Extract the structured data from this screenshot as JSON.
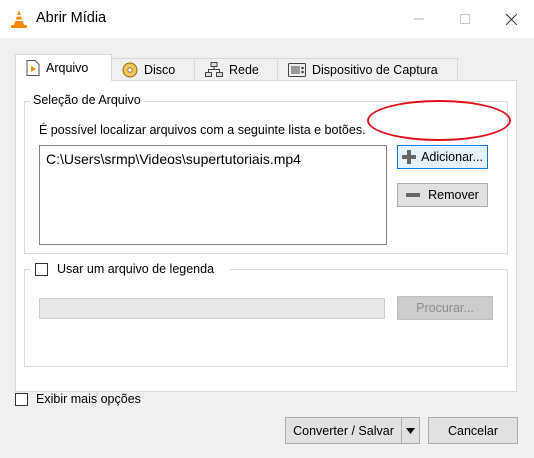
{
  "window": {
    "title": "Abrir Mídia",
    "minimize_icon": "minimize-icon",
    "maximize_icon": "maximize-icon",
    "close_icon": "close-icon"
  },
  "tabs": [
    {
      "label": "Arquivo",
      "icon": "file-play-icon",
      "active": true
    },
    {
      "label": "Disco",
      "icon": "disc-icon",
      "active": false
    },
    {
      "label": "Rede",
      "icon": "network-icon",
      "active": false
    },
    {
      "label": "Dispositivo de Captura",
      "icon": "capture-device-icon",
      "active": false
    }
  ],
  "file_selection": {
    "legend": "Seleção de Arquivo",
    "hint": "É possível localizar arquivos com a seguinte lista e botões.",
    "files": [
      "C:\\Users\\srmp\\Videos\\supertutoriais.mp4"
    ],
    "add_label": "Adicionar...",
    "remove_label": "Remover"
  },
  "subtitle": {
    "checkbox_label": "Usar um arquivo de legenda",
    "checked": false,
    "path_value": "",
    "browse_label": "Procurar..."
  },
  "more_options": {
    "label": "Exibir mais opções",
    "checked": false
  },
  "footer": {
    "convert_label": "Converter / Salvar",
    "cancel_label": "Cancelar"
  },
  "colors": {
    "highlight": "#e0121b",
    "focus_border": "#0078d7",
    "vlc_orange": "#f28a00"
  }
}
